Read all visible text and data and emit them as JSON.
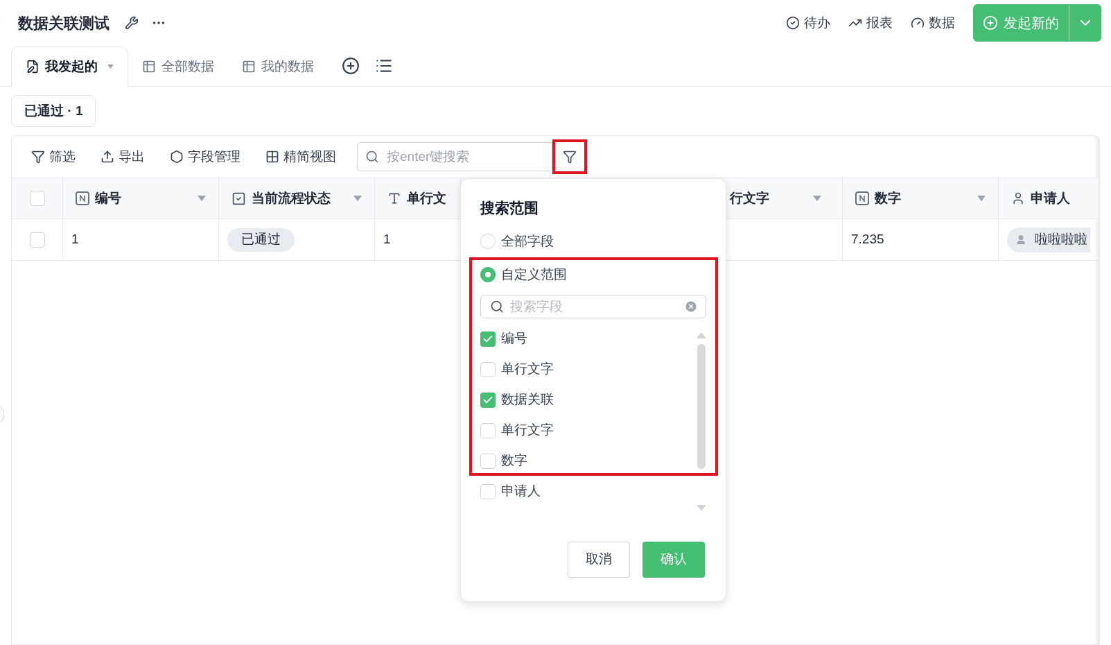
{
  "header": {
    "title": "数据关联测试",
    "actions": [
      {
        "kind": "todo",
        "label": "待办"
      },
      {
        "kind": "report",
        "label": "报表"
      },
      {
        "kind": "data",
        "label": "数据"
      }
    ],
    "primary_button": "发起新的"
  },
  "view_tabs": [
    {
      "kind": "form",
      "label": "我发起的",
      "selected": true
    },
    {
      "kind": "table",
      "label": "全部数据",
      "selected": false
    },
    {
      "kind": "table",
      "label": "我的数据",
      "selected": false
    }
  ],
  "status_chips": [
    {
      "label": "已通过 · 1"
    }
  ],
  "toolbar": {
    "buttons": [
      {
        "kind": "filter",
        "label": "筛选"
      },
      {
        "kind": "export",
        "label": "导出"
      },
      {
        "kind": "fields",
        "label": "字段管理"
      },
      {
        "kind": "compact",
        "label": "精简视图"
      }
    ],
    "search": {
      "placeholder": "按enter键搜索"
    },
    "filter_button": {
      "highlighted": true
    }
  },
  "table": {
    "all_checked": false,
    "columns": [
      {
        "kind": "number",
        "label": "编号",
        "sortable": true
      },
      {
        "kind": "checkbox",
        "label": "当前流程状态",
        "sortable": true
      },
      {
        "kind": "text",
        "label": "单行文",
        "sortable": false
      },
      {
        "label": "行文字",
        "sortable": true
      },
      {
        "kind": "number",
        "label": "数字",
        "sortable": true
      },
      {
        "kind": "person",
        "label": "申请人",
        "sortable": false
      }
    ],
    "rows": [
      {
        "checked": false,
        "cells": [
          {
            "kind": "text",
            "text": "1"
          },
          {
            "kind": "tag",
            "text": "已通过"
          },
          {
            "kind": "text",
            "text": "1"
          },
          {
            "kind": "empty"
          },
          {
            "kind": "text",
            "text": "7.235"
          },
          {
            "kind": "person",
            "text": "啦啦啦啦"
          }
        ]
      }
    ]
  },
  "search_popup": {
    "title": "搜索范围",
    "highlighted": true,
    "scopes": [
      {
        "label": "全部字段",
        "selected": false
      },
      {
        "label": "自定义范围",
        "selected": true
      }
    ],
    "field_search": {
      "placeholder": "搜索字段"
    },
    "fields": [
      {
        "label": "编号",
        "checked": true
      },
      {
        "label": "单行文字",
        "checked": false
      },
      {
        "label": "数据关联",
        "checked": true
      },
      {
        "label": "单行文字",
        "checked": false
      },
      {
        "label": "数字",
        "checked": false
      },
      {
        "label": "申请人",
        "checked": false
      }
    ],
    "buttons": [
      {
        "kind": "secondary",
        "label": "取消"
      },
      {
        "kind": "primary",
        "label": "确认"
      }
    ]
  }
}
